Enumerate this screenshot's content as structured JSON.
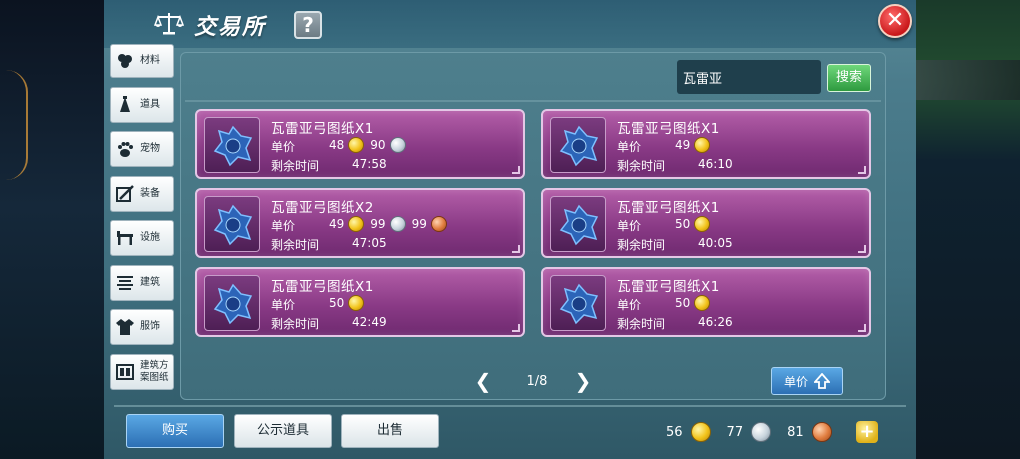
{
  "header": {
    "title": "交易所",
    "help_label": "?",
    "close_label": "✕"
  },
  "sidebar": {
    "items": [
      {
        "label": "材料",
        "icon": "materials-icon"
      },
      {
        "label": "道具",
        "icon": "item-icon"
      },
      {
        "label": "宠物",
        "icon": "paw-icon"
      },
      {
        "label": "装备",
        "icon": "equipment-icon"
      },
      {
        "label": "设施",
        "icon": "facility-icon"
      },
      {
        "label": "建筑",
        "icon": "building-icon"
      },
      {
        "label": "服饰",
        "icon": "clothing-icon"
      },
      {
        "label": "建筑方案图纸",
        "icon": "blueprint-icon"
      }
    ]
  },
  "search": {
    "value": "瓦雷亚",
    "button_label": "搜索"
  },
  "listings": [
    {
      "name": "瓦雷亚弓图纸X1",
      "price_label": "单价",
      "time_label": "剩余时间",
      "gold": "48",
      "silver": "90",
      "copper": "",
      "time": "47:58"
    },
    {
      "name": "瓦雷亚弓图纸X1",
      "price_label": "单价",
      "time_label": "剩余时间",
      "gold": "49",
      "silver": "",
      "copper": "",
      "time": "46:10"
    },
    {
      "name": "瓦雷亚弓图纸X2",
      "price_label": "单价",
      "time_label": "剩余时间",
      "gold": "49",
      "silver": "99",
      "copper": "99",
      "time": "47:05"
    },
    {
      "name": "瓦雷亚弓图纸X1",
      "price_label": "单价",
      "time_label": "剩余时间",
      "gold": "50",
      "silver": "",
      "copper": "",
      "time": "40:05"
    },
    {
      "name": "瓦雷亚弓图纸X1",
      "price_label": "单价",
      "time_label": "剩余时间",
      "gold": "50",
      "silver": "",
      "copper": "",
      "time": "42:49"
    },
    {
      "name": "瓦雷亚弓图纸X1",
      "price_label": "单价",
      "time_label": "剩余时间",
      "gold": "50",
      "silver": "",
      "copper": "",
      "time": "46:26"
    }
  ],
  "pagination": {
    "prev": "❮",
    "page": "1/8",
    "next": "❯"
  },
  "sort": {
    "label": "单价"
  },
  "actions": {
    "buy": "购买",
    "show_items": "公示道具",
    "sell": "出售"
  },
  "wallet": {
    "gold": "56",
    "silver": "77",
    "copper": "81",
    "add_label": "+"
  },
  "colors": {
    "listing_card": "#9a4894",
    "buy_button": "#3c88cc",
    "search_button": "#43b554",
    "close_button": "#d8262a"
  }
}
